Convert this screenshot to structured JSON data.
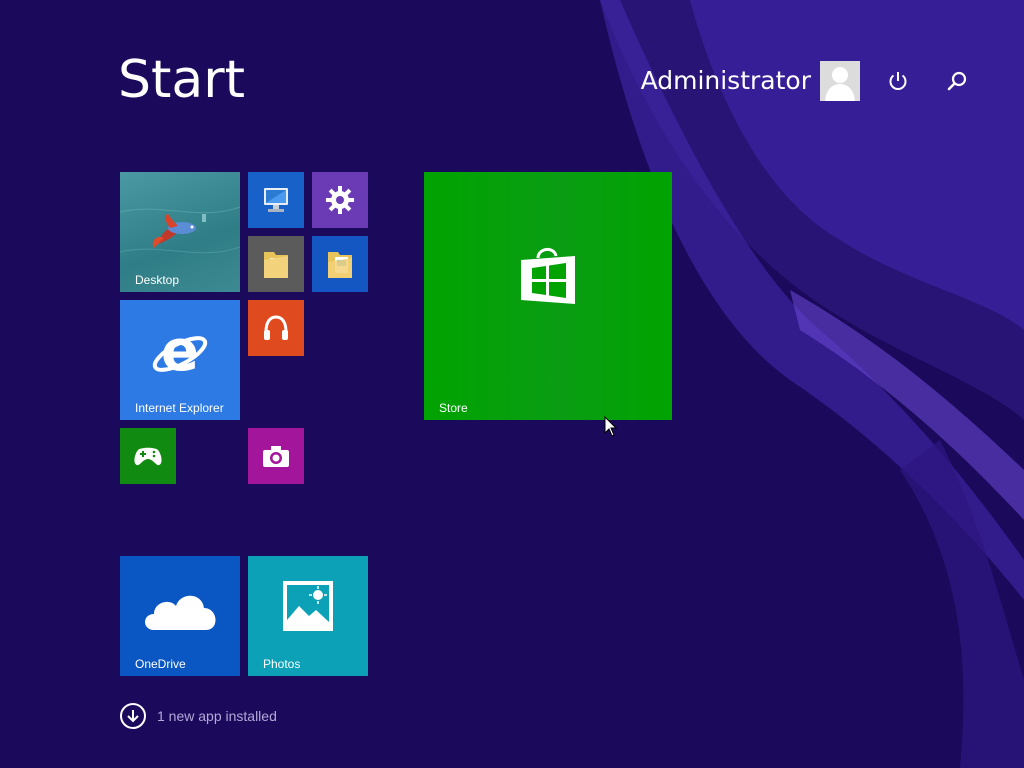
{
  "header": {
    "title": "Start",
    "user_name": "Administrator",
    "avatar_icon": "user-avatar-icon",
    "power_icon": "power-icon",
    "search_icon": "search-icon"
  },
  "tiles": {
    "desktop": {
      "label": "Desktop",
      "color": "#3a8c96",
      "icon": "betta-fish-wallpaper"
    },
    "this_pc": {
      "label": "",
      "color": "#1761c8",
      "icon": "computer-icon"
    },
    "settings": {
      "label": "",
      "color": "#6b3ab5",
      "icon": "gear-icon"
    },
    "file_explorer": {
      "label": "",
      "color": "#5b5b5b",
      "icon": "folder-icon"
    },
    "documents": {
      "label": "",
      "color": "#1457c2",
      "icon": "folder-document-icon"
    },
    "internet_explorer": {
      "label": "Internet Explorer",
      "color": "#2d7ae5",
      "icon": "internet-explorer-icon"
    },
    "music": {
      "label": "",
      "color": "#df4a1f",
      "icon": "headphones-icon"
    },
    "games": {
      "label": "",
      "color": "#118a11",
      "icon": "game-controller-icon"
    },
    "camera": {
      "label": "",
      "color": "#a3159b",
      "icon": "camera-icon"
    },
    "store": {
      "label": "Store",
      "color": "#00a300",
      "icon": "store-bag-icon"
    },
    "onedrive": {
      "label": "OneDrive",
      "color": "#0a56c2",
      "icon": "cloud-icon"
    },
    "photos": {
      "label": "Photos",
      "color": "#0ca1b6",
      "icon": "photo-landscape-icon"
    }
  },
  "notification": {
    "text": "1 new app installed",
    "icon": "arrow-down-circle-icon"
  },
  "colors": {
    "background": "#1b0a5c",
    "accent": "#5a34b0"
  }
}
